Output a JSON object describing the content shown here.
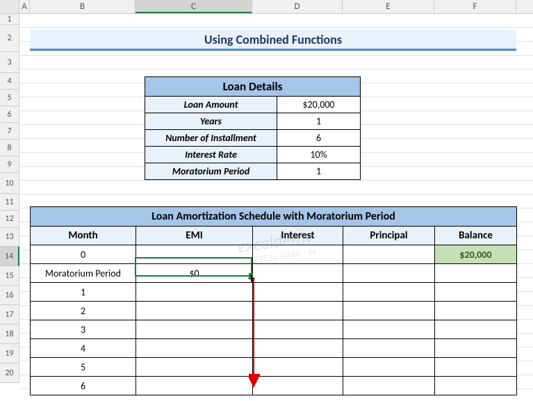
{
  "columns": [
    "A",
    "B",
    "C",
    "D",
    "E",
    "F"
  ],
  "row_count": 20,
  "selected_row": 14,
  "title": "Using Combined Functions",
  "loan_details": {
    "header": "Loan Details",
    "rows": [
      {
        "label": "Loan Amount",
        "value": "$20,000"
      },
      {
        "label": "Years",
        "value": "1"
      },
      {
        "label": "Number of Installment",
        "value": "6"
      },
      {
        "label": "Interest Rate",
        "value": "10%"
      },
      {
        "label": "Moratorium Period",
        "value": "1"
      }
    ]
  },
  "amort": {
    "title": "Loan Amortization Schedule with Moratorium Period",
    "headers": [
      "Month",
      "EMI",
      "Interest",
      "Principal",
      "Balance"
    ],
    "rows": [
      {
        "month": "0",
        "emi": "",
        "interest": "",
        "principal": "",
        "balance": "$20,000",
        "balance_start": true
      },
      {
        "month": "Moratorium Period",
        "emi": "$0",
        "interest": "",
        "principal": "",
        "balance": ""
      },
      {
        "month": "1",
        "emi": "",
        "interest": "",
        "principal": "",
        "balance": ""
      },
      {
        "month": "2",
        "emi": "",
        "interest": "",
        "principal": "",
        "balance": ""
      },
      {
        "month": "3",
        "emi": "",
        "interest": "",
        "principal": "",
        "balance": ""
      },
      {
        "month": "4",
        "emi": "",
        "interest": "",
        "principal": "",
        "balance": ""
      },
      {
        "month": "5",
        "emi": "",
        "interest": "",
        "principal": "",
        "balance": ""
      },
      {
        "month": "6",
        "emi": "",
        "interest": "",
        "principal": "",
        "balance": ""
      }
    ]
  },
  "watermark": {
    "main": "exceldemy",
    "sub": "MS EXCEL DATA · BI"
  },
  "chart_data": {
    "type": "table",
    "title": "Loan Amortization Schedule with Moratorium Period",
    "loan_amount": 20000,
    "years": 1,
    "number_of_installment": 6,
    "interest_rate_pct": 10,
    "moratorium_period": 1,
    "schedule_columns": [
      "Month",
      "EMI",
      "Interest",
      "Principal",
      "Balance"
    ],
    "schedule_rows": [
      {
        "month": 0,
        "emi": null,
        "interest": null,
        "principal": null,
        "balance": 20000
      },
      {
        "month": "Moratorium Period",
        "emi": 0,
        "interest": null,
        "principal": null,
        "balance": null
      },
      {
        "month": 1,
        "emi": null,
        "interest": null,
        "principal": null,
        "balance": null
      },
      {
        "month": 2,
        "emi": null,
        "interest": null,
        "principal": null,
        "balance": null
      },
      {
        "month": 3,
        "emi": null,
        "interest": null,
        "principal": null,
        "balance": null
      },
      {
        "month": 4,
        "emi": null,
        "interest": null,
        "principal": null,
        "balance": null
      },
      {
        "month": 5,
        "emi": null,
        "interest": null,
        "principal": null,
        "balance": null
      },
      {
        "month": 6,
        "emi": null,
        "interest": null,
        "principal": null,
        "balance": null
      }
    ]
  }
}
